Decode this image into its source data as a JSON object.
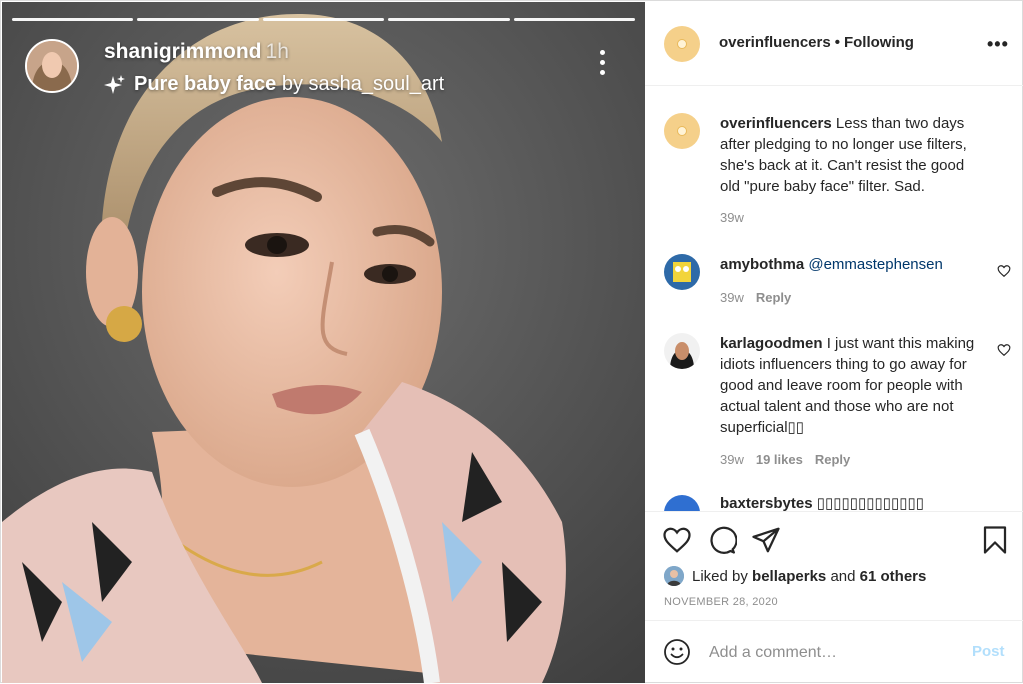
{
  "story": {
    "username": "shanigrimmond",
    "time": "1h",
    "filter_name": "Pure baby face",
    "filter_by": "by sasha_soul_art",
    "progress_segments": 5
  },
  "header": {
    "username": "overinfluencers",
    "separator": "•",
    "follow_status": "Following",
    "more": "•••"
  },
  "caption": {
    "username": "overinfluencers",
    "text": "Less than two days after pledging to no longer use filters, she's back at it. Can't resist the good old \"pure baby face\" filter. Sad.",
    "age": "39w"
  },
  "comments": [
    {
      "username": "amybothma",
      "mention": "@emmastephensen",
      "age": "39w",
      "reply": "Reply"
    },
    {
      "username": "karlagoodmen",
      "text": "I just want this making idiots influencers thing to go away for good and leave room for people with actual talent and those who are not superficial▯▯",
      "age": "39w",
      "likes": "19 likes",
      "reply": "Reply"
    },
    {
      "username": "baxtersbytes",
      "text": "▯▯▯▯▯▯▯▯▯▯▯▯▯"
    }
  ],
  "actions": {
    "liked_prefix": "Liked by",
    "liked_user": "bellaperks",
    "liked_and": "and",
    "liked_others": "61 others",
    "date": "NOVEMBER 28, 2020"
  },
  "add_comment": {
    "placeholder": "Add a comment…",
    "post_label": "Post"
  },
  "colors": {
    "link": "#00376b",
    "muted": "#8e8e8e",
    "post_disabled": "#b2dffc"
  },
  "icons": [
    "sparkle-icon",
    "more-vertical-icon",
    "more-horizontal-icon",
    "heart-icon",
    "comment-icon",
    "share-icon",
    "bookmark-icon",
    "emoji-icon"
  ]
}
